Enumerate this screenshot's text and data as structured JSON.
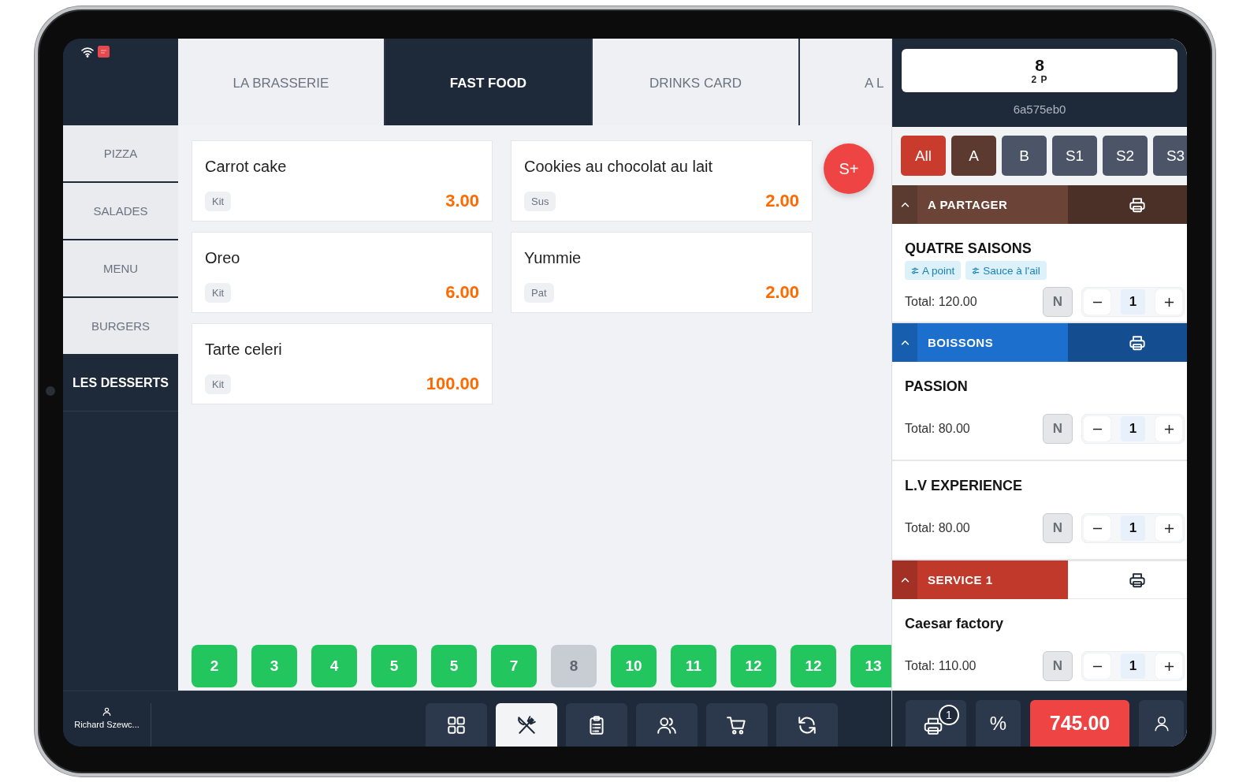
{
  "sidebar": {
    "categories": [
      {
        "label": "PIZZA",
        "selected": false
      },
      {
        "label": "SALADES",
        "selected": false
      },
      {
        "label": "MENU",
        "selected": false
      },
      {
        "label": "BURGERS",
        "selected": false
      },
      {
        "label": "LES DESSERTS",
        "selected": true
      }
    ]
  },
  "menu_tabs": [
    {
      "label": "LA BRASSERIE",
      "selected": false
    },
    {
      "label": "FAST FOOD",
      "selected": true
    },
    {
      "label": "DRINKS CARD",
      "selected": false
    },
    {
      "label": "A L",
      "selected": false
    }
  ],
  "products": [
    {
      "name": "Carrot cake",
      "tag": "Kit",
      "price": "3.00"
    },
    {
      "name": "Cookies au chocolat au lait",
      "tag": "Sus",
      "price": "2.00"
    },
    {
      "name": "Oreo",
      "tag": "Kit",
      "price": "6.00"
    },
    {
      "name": "Yummie",
      "tag": "Pat",
      "price": "2.00"
    },
    {
      "name": "Tarte celeri",
      "tag": "Kit",
      "price": "100.00"
    }
  ],
  "quick_add_button": "S+",
  "number_buttons": [
    {
      "label": "2",
      "disabled": false
    },
    {
      "label": "3",
      "disabled": false
    },
    {
      "label": "4",
      "disabled": false
    },
    {
      "label": "5",
      "disabled": false
    },
    {
      "label": "5",
      "disabled": false
    },
    {
      "label": "7",
      "disabled": false
    },
    {
      "label": "8",
      "disabled": true
    },
    {
      "label": "10",
      "disabled": false
    },
    {
      "label": "11",
      "disabled": false
    },
    {
      "label": "12",
      "disabled": false
    },
    {
      "label": "12",
      "disabled": false
    },
    {
      "label": "13",
      "disabled": false
    }
  ],
  "user": {
    "name": "Richard Szewc..."
  },
  "toolbar": [
    {
      "selected": false
    },
    {
      "selected": true
    },
    {
      "selected": false
    },
    {
      "selected": false
    },
    {
      "selected": false
    },
    {
      "selected": false
    }
  ],
  "order": {
    "table_number": "8",
    "guests": "2 P",
    "order_id": "6a575eb0",
    "filters": [
      {
        "label": "All",
        "color": "#c93b2d"
      },
      {
        "label": "A",
        "color": "#5c3a30"
      },
      {
        "label": "B",
        "color": "#4b5567"
      },
      {
        "label": "S1",
        "color": "#4b5567"
      },
      {
        "label": "S2",
        "color": "#4b5567"
      },
      {
        "label": "S3",
        "color": "#4b5567"
      }
    ],
    "sections": [
      {
        "title": "A PARTAGER",
        "color": "#6b4437",
        "expanded": true,
        "sent": true,
        "items": [
          {
            "name": "QUATRE SAISONS",
            "modifiers": [
              "A point",
              "Sauce à l'ail"
            ],
            "total": "Total: 120.00",
            "note_button": "N",
            "quantity": "1"
          }
        ]
      },
      {
        "title": "BOISSONS",
        "color": "#1c6fcd",
        "expanded": true,
        "sent": true,
        "items": [
          {
            "name": "PASSION",
            "total": "Total: 80.00",
            "note_button": "N",
            "quantity": "1"
          },
          {
            "name": "L.V EXPERIENCE",
            "total": "Total: 80.00",
            "note_button": "N",
            "quantity": "1"
          }
        ]
      },
      {
        "title": "SERVICE 1",
        "color": "#c0392b",
        "expanded": true,
        "sent": false,
        "items": [
          {
            "name": "Caesar factory",
            "total": "Total: 110.00",
            "note_button": "N",
            "quantity": "1"
          }
        ]
      }
    ]
  },
  "footer": {
    "print_badge": "1",
    "discount_button": "%",
    "total": "745.00"
  }
}
